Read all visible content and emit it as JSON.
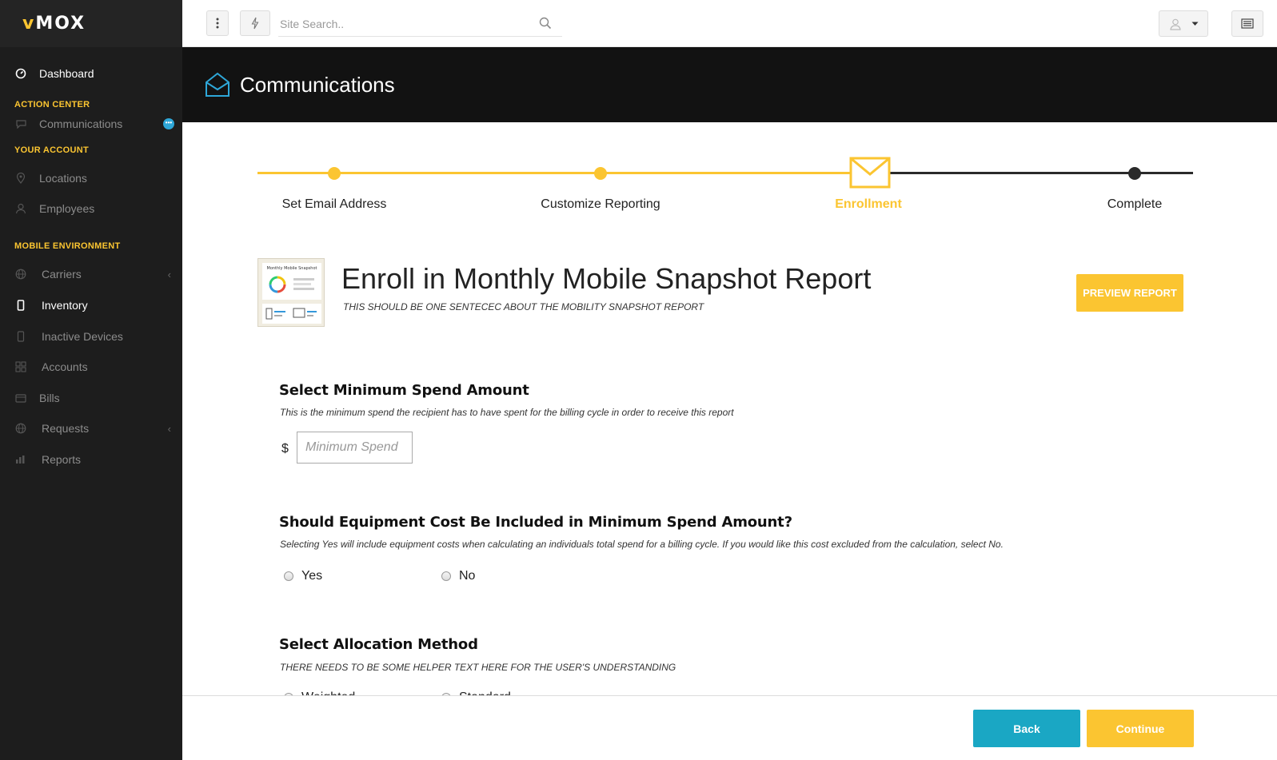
{
  "app": {
    "logo_accent": "v",
    "logo_text": "MOX"
  },
  "colors": {
    "accent": "#fbc531",
    "teal": "#1aa7c4",
    "dark": "#121212",
    "sidebar": "#1d1d1d"
  },
  "sidebar": {
    "dashboard": "Dashboard",
    "action_center_label": "ACTION CENTER",
    "communications": "Communications",
    "communications_badge": "•••",
    "your_account_label": "YOUR ACCOUNT",
    "locations": "Locations",
    "employees": "Employees",
    "mobile_env_label": "MOBILE ENVIRONMENT",
    "carriers": "Carriers",
    "inventory": "Inventory",
    "inactive_devices": "Inactive Devices",
    "accounts": "Accounts",
    "bills": "Bills",
    "requests": "Requests",
    "reports": "Reports"
  },
  "topbar": {
    "search_placeholder": "Site Search.."
  },
  "header": {
    "title": "Communications"
  },
  "stepper": {
    "steps": [
      "Set Email Address",
      "Customize Reporting",
      "Enrollment",
      "Complete"
    ],
    "current_step": 3
  },
  "report": {
    "title": "Enroll in Monthly Mobile Snapshot Report",
    "subtitle": "THIS SHOULD BE ONE SENTECEC ABOUT THE MOBILITY SNAPSHOT REPORT",
    "preview_label": "PREVIEW REPORT",
    "thumb_title": "Monthly Mobile Snapshot"
  },
  "min_spend": {
    "title": "Select Minimum Spend Amount",
    "help": "This is the minimum spend the recipient has to have spent for the billing cycle in order to receive this report",
    "currency": "$",
    "placeholder": "Minimum Spend"
  },
  "equipment": {
    "title": "Should Equipment Cost Be Included in Minimum Spend Amount?",
    "help": "Selecting Yes will include equipment costs when calculating an individuals total spend for a billing cycle.  If you would like this cost excluded from the calculation, select No.",
    "yes": "Yes",
    "no": "No"
  },
  "allocation": {
    "title": "Select Allocation Method",
    "help": "THERE NEEDS TO BE SOME HELPER TEXT HERE FOR THE USER'S UNDERSTANDING",
    "weighted": "Weighted",
    "standard": "Standard"
  },
  "footer": {
    "back": "Back",
    "continue": "Continue"
  }
}
